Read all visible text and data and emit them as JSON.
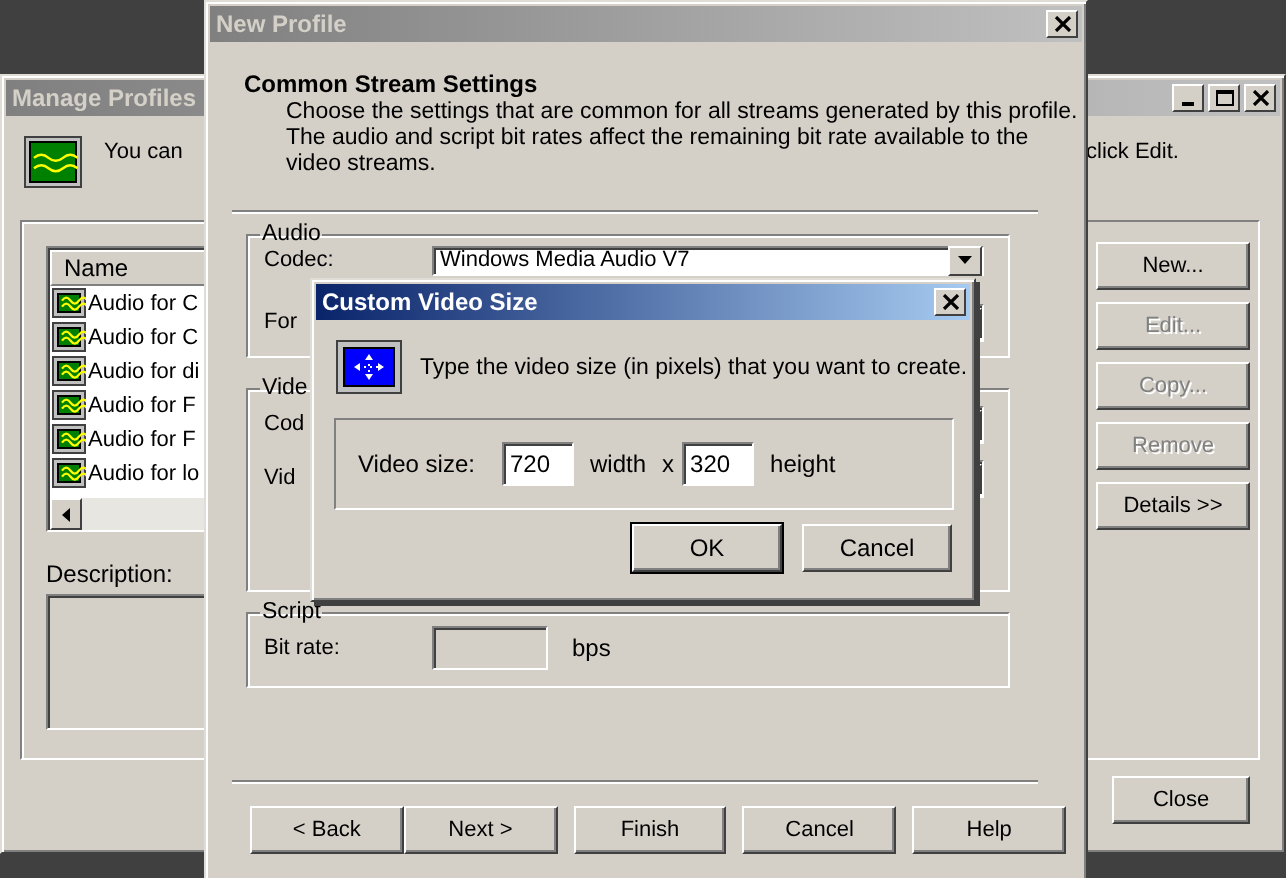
{
  "manage_profiles": {
    "title": "Manage Profiles",
    "active": false,
    "intro": [
      "You can",
      "click Edit."
    ],
    "list": {
      "column": "Name",
      "rows": [
        "Audio for C",
        "Audio for C",
        "Audio for di",
        "Audio for F",
        "Audio for F",
        "Audio for lo"
      ]
    },
    "description_label": "Description:",
    "buttons": [
      {
        "label": "New...",
        "disabled": false
      },
      {
        "label": "Edit...",
        "disabled": true
      },
      {
        "label": "Copy...",
        "disabled": true
      },
      {
        "label": "Remove",
        "disabled": true
      },
      {
        "label": "Details >>",
        "disabled": false
      }
    ],
    "close_button": "Close"
  },
  "new_profile": {
    "title": "New Profile",
    "active": false,
    "heading": "Common Stream Settings",
    "description": "Choose the settings that are common for all streams generated by this profile.\nThe audio and script bit rates affect the remaining bit rate available to the\nvideo streams.",
    "groups": [
      {
        "title": "Audio",
        "rows": [
          {
            "kind": "combo",
            "label": "Codec:",
            "value": "Windows Media Audio V7"
          },
          {
            "kind": "combo",
            "label": "For"
          }
        ]
      },
      {
        "title": "Vide",
        "rows": [
          {
            "kind": "combo",
            "label": "Cod"
          },
          {
            "kind": "combo",
            "label": "Vid"
          }
        ]
      },
      {
        "title": "Script",
        "rows": [
          {
            "kind": "field",
            "label": "Bit rate:",
            "unit": "bps",
            "disabled": true
          }
        ]
      }
    ],
    "buttons": [
      "< Back",
      "Next >",
      "Finish",
      "Cancel",
      "Help"
    ]
  },
  "custom_video_size": {
    "title": "Custom Video Size",
    "active": true,
    "message": "Type the video size (in pixels) that you want to create.",
    "size_label": "Video size:",
    "width_value": "720",
    "width_label": "width",
    "separator": "x",
    "height_value": "320",
    "height_label": "height",
    "buttons": [
      {
        "label": "OK",
        "default": true
      },
      {
        "label": "Cancel",
        "default": false
      }
    ]
  }
}
